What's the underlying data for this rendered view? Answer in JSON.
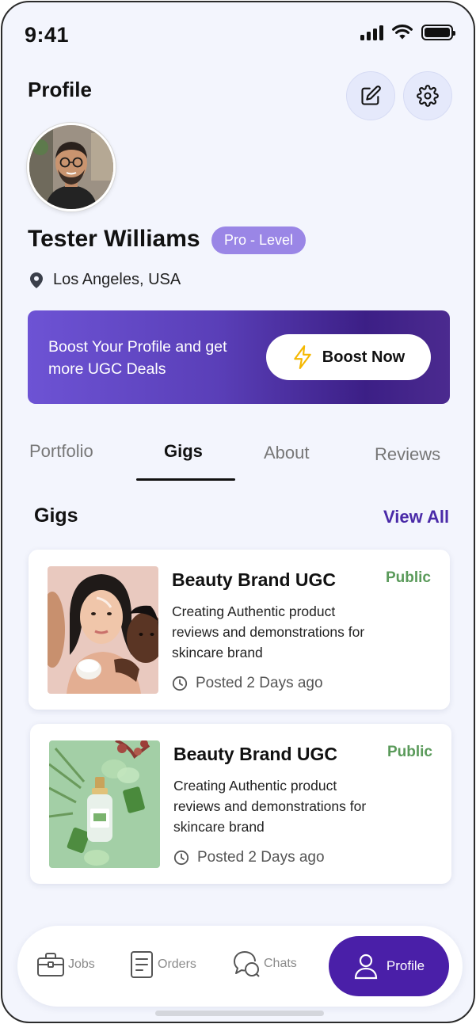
{
  "status_bar": {
    "time": "9:41"
  },
  "header": {
    "title": "Profile",
    "edit_icon": "edit-icon",
    "settings_icon": "gear-icon"
  },
  "profile": {
    "name": "Tester Williams",
    "level": "Pro - Level",
    "location": "Los Angeles, USA"
  },
  "boost": {
    "text": "Boost Your Profile and get more UGC Deals",
    "button_label": "Boost Now",
    "icon": "lightning-icon",
    "colors": {
      "start": "#6d53d4",
      "end": "#3c1f86",
      "bolt": "#f5b800"
    }
  },
  "tabs": [
    {
      "label": "Portfolio",
      "active": false
    },
    {
      "label": "Gigs",
      "active": true
    },
    {
      "label": "About",
      "active": false
    },
    {
      "label": "Reviews",
      "active": false
    }
  ],
  "gigs_section": {
    "title": "Gigs",
    "view_all": "View All",
    "items": [
      {
        "title": "Beauty Brand UGC",
        "status": "Public",
        "description": "Creating Authentic product reviews and demonstrations for skincare brand",
        "posted": "Posted 2 Days ago"
      },
      {
        "title": "Beauty Brand UGC",
        "status": "Public",
        "description": "Creating Authentic product reviews and demonstrations for skincare brand",
        "posted": "Posted 2 Days ago"
      }
    ]
  },
  "bottom_nav": {
    "items": [
      {
        "label": "Jobs",
        "icon": "briefcase-icon",
        "active": false
      },
      {
        "label": "Orders",
        "icon": "document-icon",
        "active": false
      },
      {
        "label": "Chats",
        "icon": "chat-bubbles-icon",
        "active": false
      },
      {
        "label": "Profile",
        "icon": "user-icon",
        "active": true
      }
    ]
  },
  "colors": {
    "accent": "#4a1fa8",
    "public_status": "#5a9a5a",
    "background": "#f3f5fd",
    "level_badge": "#9a86e6"
  }
}
